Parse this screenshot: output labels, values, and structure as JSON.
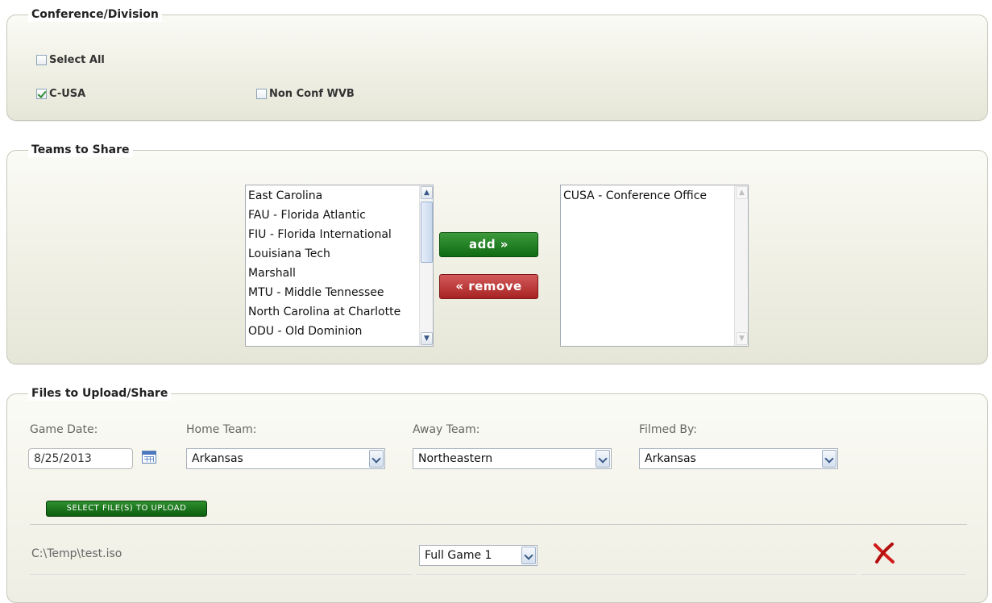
{
  "conference_division": {
    "legend": "Conference/Division",
    "select_all_label": "Select All",
    "select_all_checked": false,
    "options": [
      {
        "label": "C-USA",
        "checked": true
      },
      {
        "label": "Non Conf WVB",
        "checked": false
      }
    ]
  },
  "teams_to_share": {
    "legend": "Teams to Share",
    "available_teams": [
      "East Carolina",
      "FAU - Florida Atlantic",
      "FIU - Florida International",
      "Louisiana Tech",
      "Marshall",
      "MTU - Middle Tennessee",
      "North Carolina at Charlotte",
      "ODU - Old Dominion"
    ],
    "selected_teams": [
      "CUSA - Conference Office"
    ],
    "add_label": "add »",
    "remove_label": "« remove"
  },
  "files": {
    "legend": "Files to Upload/Share",
    "game_date_label": "Game Date:",
    "game_date_value": "8/25/2013",
    "home_team_label": "Home Team:",
    "home_team_value": "Arkansas",
    "away_team_label": "Away Team:",
    "away_team_value": "Northeastern",
    "filmed_by_label": "Filmed By:",
    "filmed_by_value": "Arkansas",
    "select_files_label": "SELECT FILE(S) TO UPLOAD",
    "file_rows": [
      {
        "path": "C:\\Temp\\test.iso",
        "segment": "Full Game 1"
      }
    ]
  },
  "colors": {
    "add_button": "#1b7a1e",
    "remove_button": "#b83030",
    "delete_icon": "#d11a1a"
  }
}
